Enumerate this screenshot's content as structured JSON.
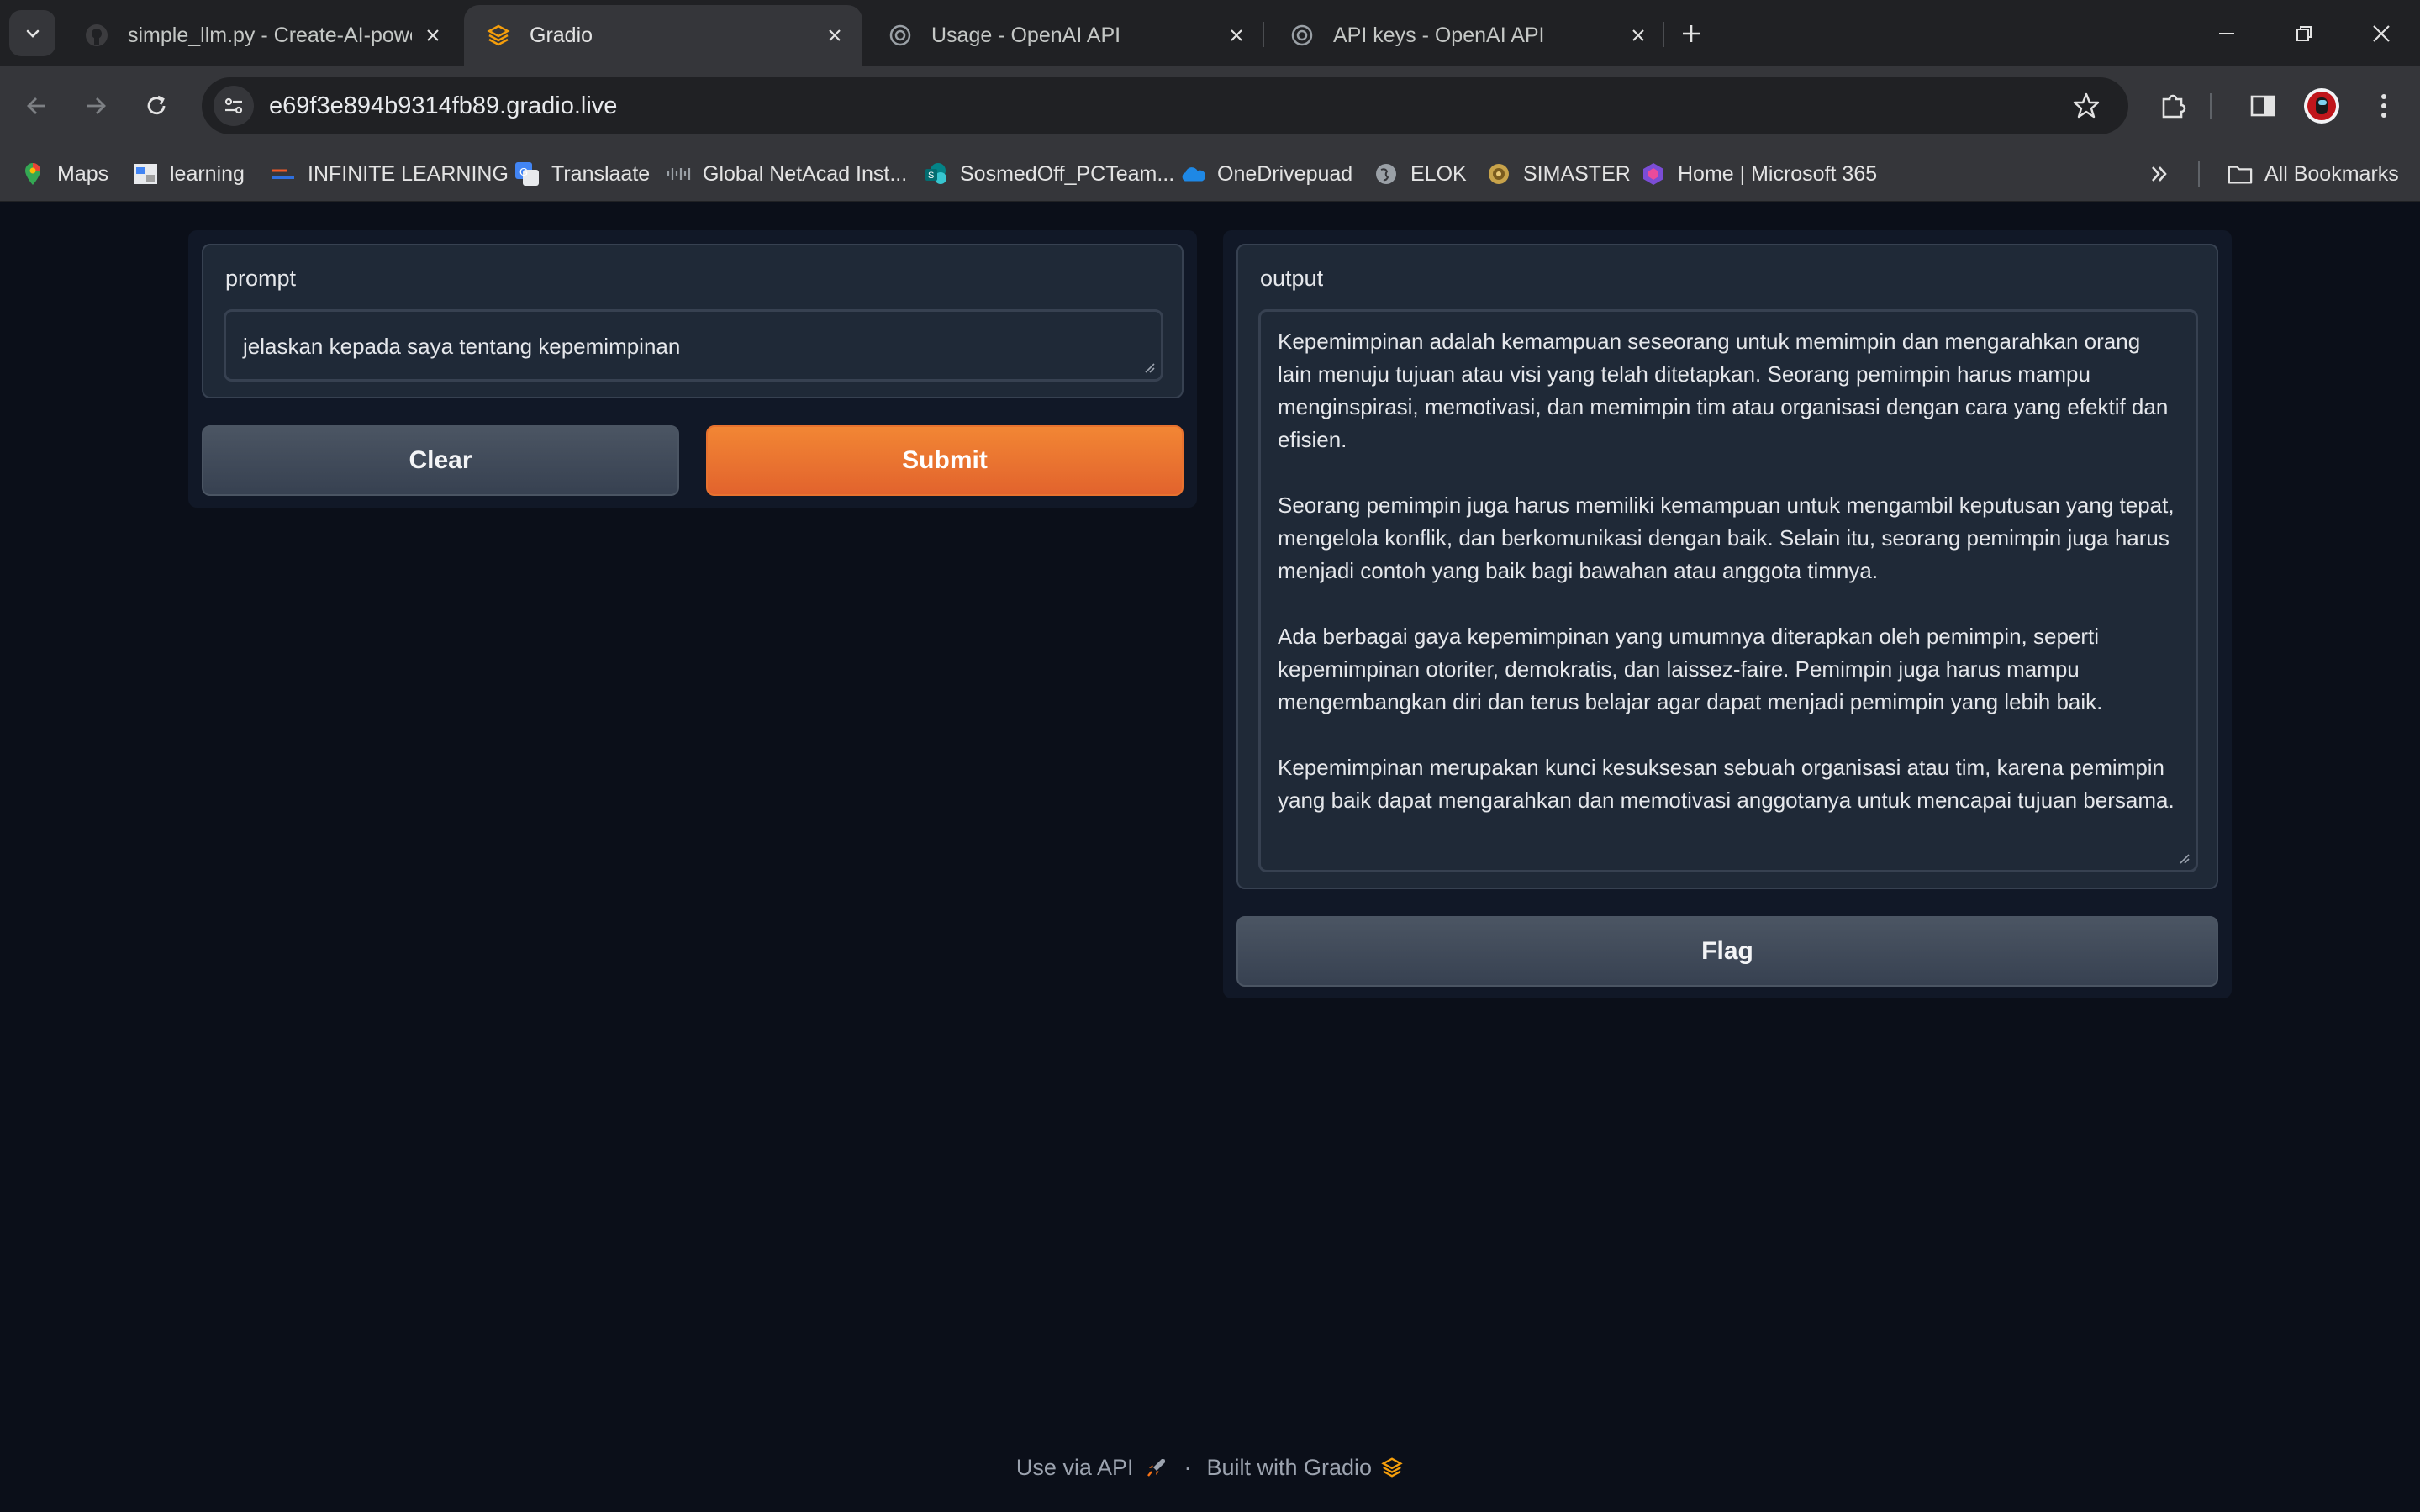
{
  "browser": {
    "tabs": [
      {
        "title": "simple_llm.py - Create-AI-powe",
        "icon": "github-icon",
        "active": false
      },
      {
        "title": "Gradio",
        "icon": "gradio-icon",
        "active": true
      },
      {
        "title": "Usage - OpenAI API",
        "icon": "openai-icon",
        "active": false
      },
      {
        "title": "API keys - OpenAI API",
        "icon": "openai-icon",
        "active": false
      }
    ],
    "url": "e69f3e894b9314fb89.gradio.live",
    "bookmarks": [
      {
        "label": "Maps",
        "icon": "maps-icon"
      },
      {
        "label": "learning",
        "icon": "learning-icon"
      },
      {
        "label": "INFINITE LEARNING",
        "icon": "infinite-learning-icon"
      },
      {
        "label": "Translaate",
        "icon": "google-translate-icon"
      },
      {
        "label": "Global NetAcad Inst...",
        "icon": "cisco-icon"
      },
      {
        "label": "SosmedOff_PCTeam...",
        "icon": "sharepoint-icon"
      },
      {
        "label": "OneDrivepuad",
        "icon": "onedrive-icon"
      },
      {
        "label": "ELOK",
        "icon": "globe-icon"
      },
      {
        "label": "SIMASTER",
        "icon": "simaster-icon"
      },
      {
        "label": "Home | Microsoft 365",
        "icon": "microsoft365-icon"
      }
    ],
    "all_bookmarks_label": "All Bookmarks"
  },
  "input_panel": {
    "prompt_label": "prompt",
    "prompt_value": "jelaskan kepada saya tentang kepemimpinan",
    "clear_label": "Clear",
    "submit_label": "Submit"
  },
  "output_panel": {
    "output_label": "output",
    "paragraphs": [
      "Kepemimpinan adalah kemampuan seseorang untuk memimpin dan mengarahkan orang lain menuju tujuan atau visi yang telah ditetapkan. Seorang pemimpin harus mampu menginspirasi, memotivasi, dan memimpin tim atau organisasi dengan cara yang efektif dan efisien.",
      "Seorang pemimpin juga harus memiliki kemampuan untuk mengambil keputusan yang tepat, mengelola konflik, dan berkomunikasi dengan baik. Selain itu, seorang pemimpin juga harus menjadi contoh yang baik bagi bawahan atau anggota timnya.",
      "Ada berbagai gaya kepemimpinan yang umumnya diterapkan oleh pemimpin, seperti kepemimpinan otoriter, demokratis, dan laissez-faire. Pemimpin juga harus mampu mengembangkan diri dan terus belajar agar dapat menjadi pemimpin yang lebih baik.",
      "Kepemimpinan merupakan kunci kesuksesan sebuah organisasi atau tim, karena pemimpin yang baik dapat mengarahkan dan memotivasi anggotanya untuk mencapai tujuan bersama."
    ],
    "flag_label": "Flag"
  },
  "footer": {
    "api_label": "Use via API",
    "separator": "·",
    "built_label": "Built with Gradio"
  },
  "colors": {
    "page_bg": "#0b0f19",
    "primary_button": "#e8722f",
    "secondary_button": "#4b5563"
  }
}
